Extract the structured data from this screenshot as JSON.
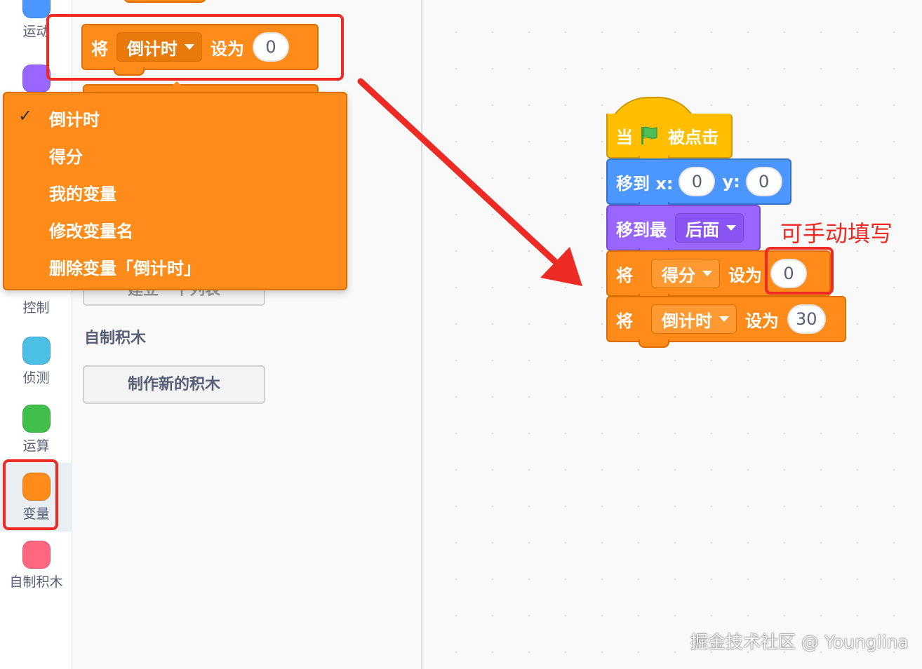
{
  "categories": [
    {
      "label": "运动",
      "color": "#4c97ff"
    },
    {
      "label": "",
      "color": "#9966ff"
    },
    {
      "label": "控制",
      "color": "#ffab19"
    },
    {
      "label": "侦测",
      "color": "#4cbfe6"
    },
    {
      "label": "运算",
      "color": "#40bf4a"
    },
    {
      "label": "变量",
      "color": "#ff8c1a"
    },
    {
      "label": "自制积木",
      "color": "#ff6680"
    }
  ],
  "palette": {
    "set_block": {
      "prefix": "将",
      "variable": "倒计时",
      "middle": "设为",
      "value": "0"
    },
    "make_list_button": "建立一个列表",
    "my_blocks_title": "自制积木",
    "make_block_button": "制作新的积木"
  },
  "dropdown": {
    "check": "✓",
    "items": [
      "倒计时",
      "得分",
      "我的变量",
      "修改变量名",
      "删除变量「倒计时」"
    ]
  },
  "workspace": {
    "hat_block": {
      "prefix": "当",
      "icon": "green-flag-icon",
      "suffix": "被点击"
    },
    "goto_block": {
      "label": "移到 x:",
      "x": "0",
      "y_label": "y:",
      "y": "0"
    },
    "layer_block": {
      "label": "移到最",
      "option": "后面"
    },
    "set_score_block": {
      "prefix": "将",
      "variable": "得分",
      "middle": "设为",
      "value": "0"
    },
    "set_timer_block": {
      "prefix": "将",
      "variable": "倒计时",
      "middle": "设为",
      "value": "30"
    },
    "annotation": "可手动填写"
  },
  "watermark": "掘金技术社区 @ Younglina",
  "colors": {
    "annotation_red": "#ee2a24",
    "variables_orange": "#ff8c1a"
  }
}
